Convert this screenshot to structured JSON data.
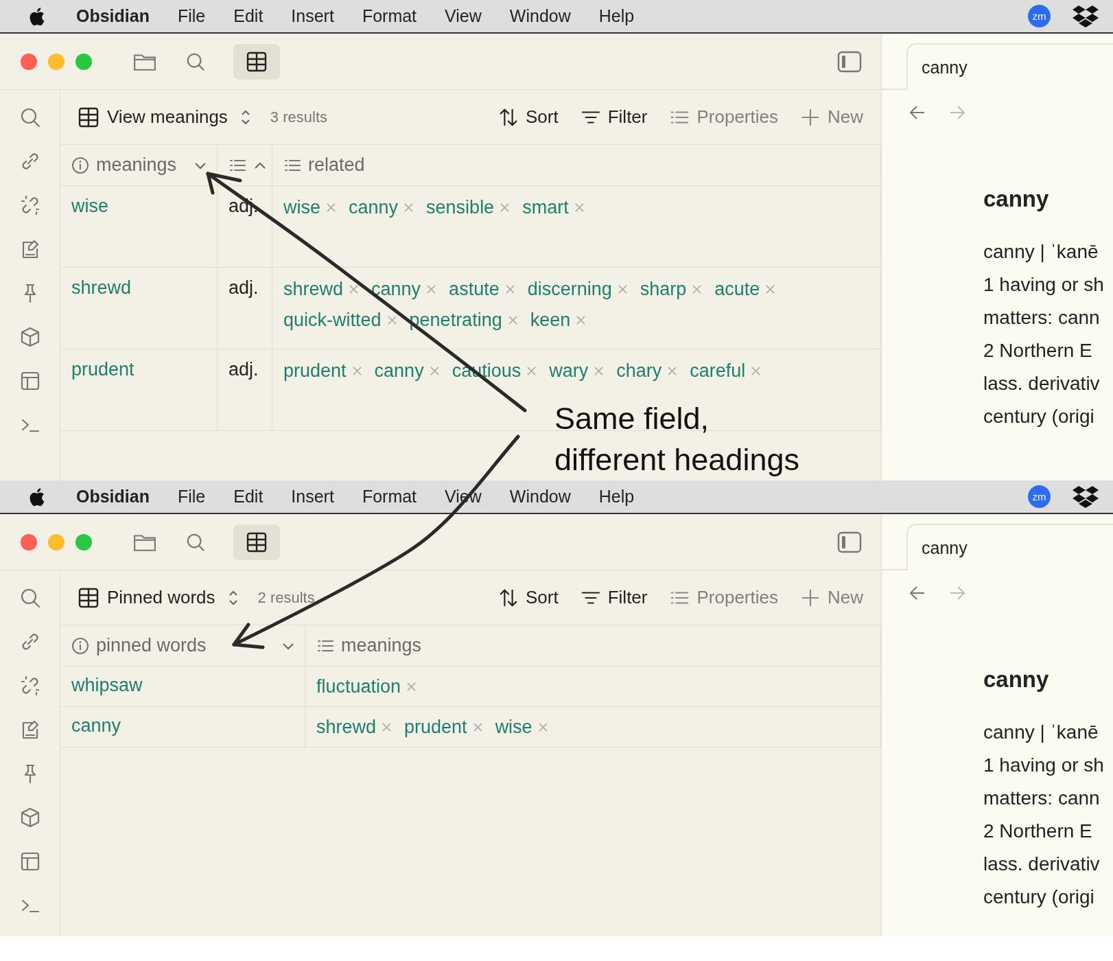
{
  "screens": [
    {
      "menubar": {
        "app": "Obsidian",
        "items": [
          "File",
          "Edit",
          "Insert",
          "Format",
          "View",
          "Window",
          "Help"
        ],
        "zoom_label": "zm"
      },
      "view": {
        "name": "View meanings",
        "results": "3 results",
        "actions": [
          {
            "kind": "sort",
            "label": "Sort",
            "muted": false
          },
          {
            "kind": "filter",
            "label": "Filter",
            "muted": false
          },
          {
            "kind": "properties",
            "label": "Properties",
            "muted": true
          },
          {
            "kind": "new",
            "label": "New",
            "muted": true
          }
        ]
      },
      "table": {
        "columns": [
          {
            "kind": "text",
            "label": "meanings",
            "ascending": false
          },
          {
            "kind": "list",
            "ascending": true
          },
          {
            "kind": "list",
            "label": "related"
          }
        ],
        "rows": [
          {
            "cells": [
              {
                "kind": "link",
                "text": "wise"
              },
              {
                "kind": "plain",
                "text": "adj."
              },
              {
                "kind": "tags",
                "items": [
                  "wise",
                  "canny",
                  "sensible",
                  "smart"
                ]
              }
            ]
          },
          {
            "cells": [
              {
                "kind": "link",
                "text": "shrewd"
              },
              {
                "kind": "plain",
                "text": "adj."
              },
              {
                "kind": "tags",
                "items": [
                  "shrewd",
                  "canny",
                  "astute",
                  "discerning",
                  "sharp",
                  "acute",
                  "quick-witted",
                  "penetrating",
                  "keen"
                ]
              }
            ]
          },
          {
            "cells": [
              {
                "kind": "link",
                "text": "prudent"
              },
              {
                "kind": "plain",
                "text": "adj."
              },
              {
                "kind": "tags",
                "items": [
                  "prudent",
                  "canny",
                  "cautious",
                  "wary",
                  "chary",
                  "careful"
                ]
              }
            ]
          }
        ]
      },
      "note": {
        "tab": "canny",
        "heading": "canny",
        "lines": [
          "canny | ˈkanē",
          "1 having or sh",
          "matters: cann",
          "2 Northern E",
          "lass. derivativ",
          "century (origi"
        ]
      }
    },
    {
      "menubar": {
        "app": "Obsidian",
        "items": [
          "File",
          "Edit",
          "Insert",
          "Format",
          "View",
          "Window",
          "Help"
        ],
        "zoom_label": "zm"
      },
      "view": {
        "name": "Pinned words",
        "results": "2 results",
        "actions": [
          {
            "kind": "sort",
            "label": "Sort",
            "muted": false
          },
          {
            "kind": "filter",
            "label": "Filter",
            "muted": false
          },
          {
            "kind": "properties",
            "label": "Properties",
            "muted": true
          },
          {
            "kind": "new",
            "label": "New",
            "muted": true
          }
        ]
      },
      "table": {
        "columns": [
          {
            "kind": "text",
            "label": "pinned words",
            "ascending": false
          },
          {
            "kind": "list",
            "label": "meanings"
          }
        ],
        "rows": [
          {
            "cells": [
              {
                "kind": "link",
                "text": "whipsaw"
              },
              {
                "kind": "tags",
                "items": [
                  "fluctuation"
                ]
              }
            ]
          },
          {
            "cells": [
              {
                "kind": "link",
                "text": "canny"
              },
              {
                "kind": "tags",
                "items": [
                  "shrewd",
                  "prudent",
                  "wise"
                ]
              }
            ]
          }
        ]
      },
      "note": {
        "tab": "canny",
        "heading": "canny",
        "lines": [
          "canny | ˈkanē",
          "1 having or sh",
          "matters: cann",
          "2 Northern E",
          "lass. derivativ",
          "century (origi"
        ]
      }
    }
  ],
  "annotation": {
    "lines": [
      "Same field,",
      "different headings"
    ]
  }
}
